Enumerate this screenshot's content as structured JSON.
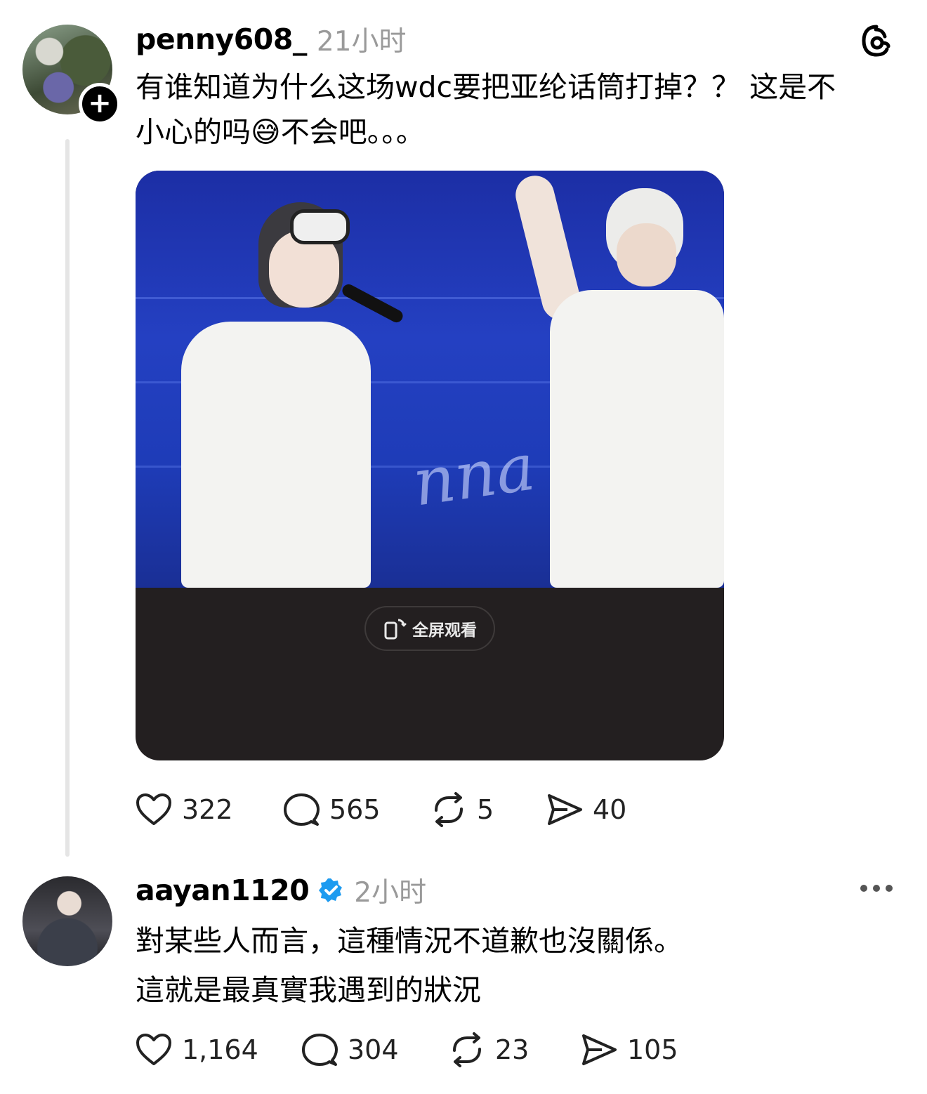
{
  "post": {
    "username": "penny608_",
    "time": "21小时",
    "text_line1": "有谁知道为什么这场wdc要把亚纶话筒打掉？？ 这是不",
    "text_line2": "小心的吗",
    "text_emoji": "😅",
    "text_line2_rest": "不会吧。。。",
    "video": {
      "fullscreen_label": "全屏观看",
      "overlay_script": "nna"
    },
    "stats": {
      "likes": "322",
      "comments": "565",
      "reposts": "5",
      "shares": "40"
    }
  },
  "reply": {
    "username": "aayan1120",
    "time": "2小时",
    "text_line1": "對某些人而言，這種情況不道歉也沒關係。",
    "text_line2": "這就是最真實我遇到的狀況",
    "stats": {
      "likes": "1,164",
      "comments": "304",
      "reposts": "23",
      "shares": "105"
    }
  },
  "icons": {
    "like": "heart-icon",
    "comment": "comment-bubble-icon",
    "repost": "repost-icon",
    "share": "send-icon",
    "app": "threads-logo-icon",
    "more": "more-dots-icon",
    "verified": "verified-badge-icon"
  },
  "colors": {
    "verified": "#1d9bf0",
    "muted": "#9a9a9a",
    "video_bg": "#231f20",
    "stage": "#2440c2"
  }
}
